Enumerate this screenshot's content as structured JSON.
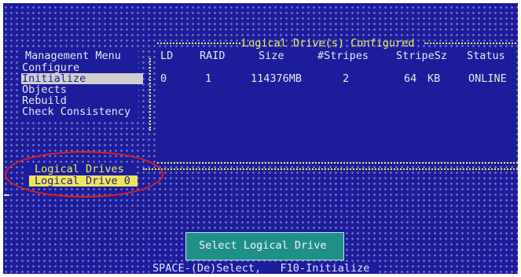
{
  "panel_title": "Logical Drive(s) Configured",
  "management_menu": {
    "title": "Management Menu",
    "items": [
      {
        "label": "Configure"
      },
      {
        "label": "Initialize",
        "selected": true
      },
      {
        "label": "Objects"
      },
      {
        "label": "Rebuild"
      },
      {
        "label": "Check Consistency"
      }
    ]
  },
  "table": {
    "columns": [
      "LD",
      "RAID",
      "Size",
      "#Stripes",
      "StripeSz",
      "Status"
    ],
    "rows": [
      {
        "ld": "0",
        "raid": "1",
        "size": "114376MB",
        "stripes": "2",
        "stripe_value": "64",
        "stripe_unit": "KB",
        "status": "ONLINE"
      }
    ]
  },
  "logical_drives": {
    "title": "Logical Drives",
    "items": [
      {
        "label": "Logical Drive 0",
        "selected": true
      }
    ]
  },
  "dialog": {
    "label": "Select Logical Drive"
  },
  "status_bar": "SPACE-(De)Select,   F10-Initialize",
  "colors": {
    "screen_bg": "#1d1d9c",
    "frame": "#f2ea55",
    "highlight": "#cfcfcf",
    "drive_highlight": "#ede65a",
    "dialog_bg": "#1f8f8a",
    "annotation": "#e11f18"
  }
}
